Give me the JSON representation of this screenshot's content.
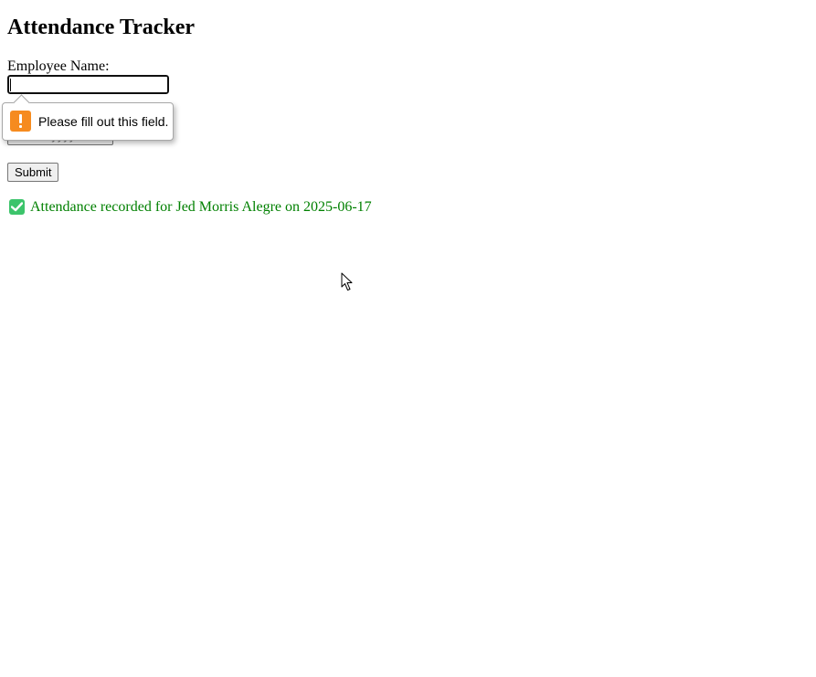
{
  "page": {
    "title": "Attendance Tracker"
  },
  "form": {
    "name_label": "Employee Name:",
    "name_value": "",
    "date_placeholder": "mm/dd/yyyy",
    "submit_label": "Submit"
  },
  "validation": {
    "message": "Please fill out this field.",
    "icon": "warning-icon",
    "icon_color": "#f68b1f"
  },
  "status": {
    "message": "Attendance recorded for Jed Morris Alegre on 2025-06-17",
    "icon": "check-mark-icon",
    "color": "#008000"
  }
}
